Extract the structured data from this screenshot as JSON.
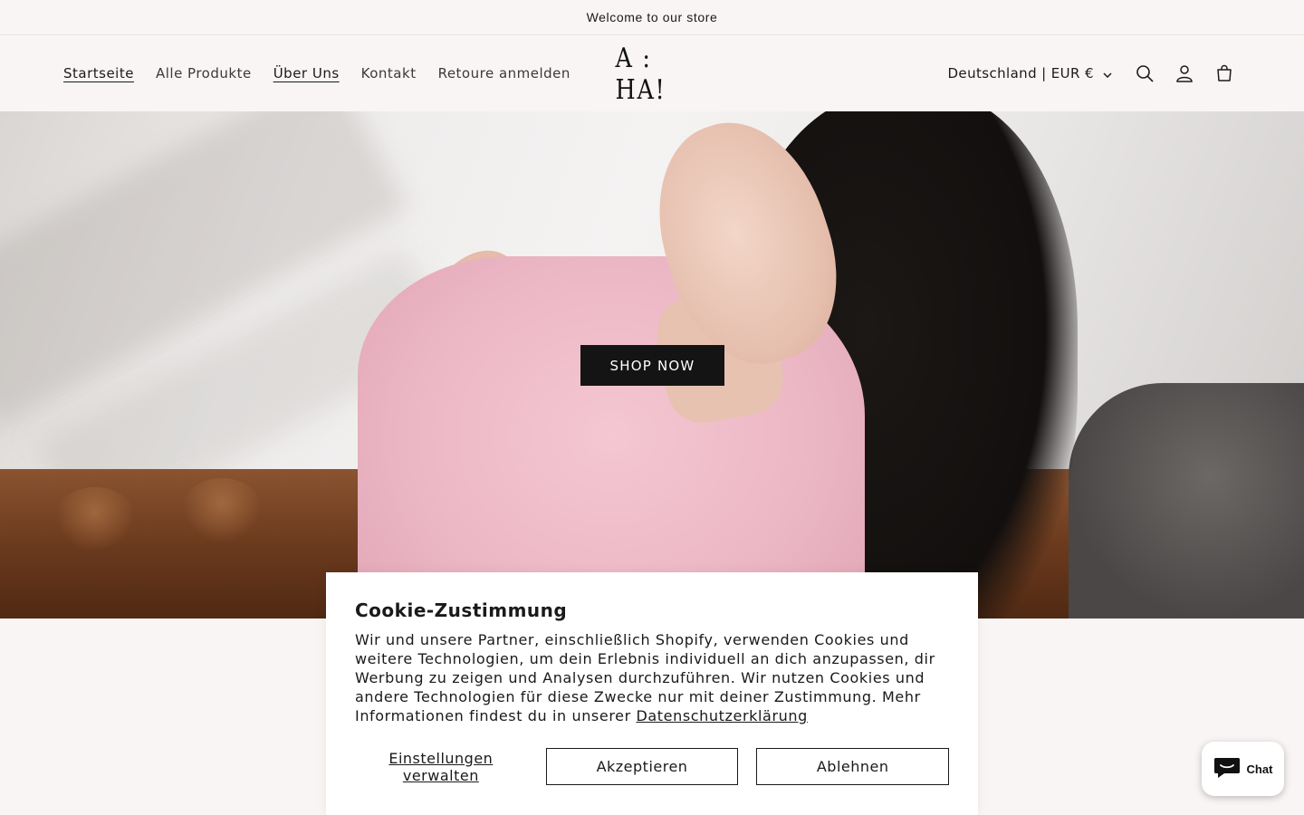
{
  "announcement": {
    "text": "Welcome to our store"
  },
  "nav": {
    "items": [
      {
        "label": "Startseite"
      },
      {
        "label": "Alle Produkte"
      },
      {
        "label": "Über Uns"
      },
      {
        "label": "Kontakt"
      },
      {
        "label": "Retoure anmelden"
      }
    ]
  },
  "logo": {
    "text": "A : HA!"
  },
  "header": {
    "country_selector": "Deutschland | EUR €",
    "icons": [
      "search-icon",
      "account-icon",
      "cart-icon"
    ]
  },
  "hero": {
    "cta_label": "SHOP NOW"
  },
  "cookie_banner": {
    "title": "Cookie-Zustimmung",
    "body": "Wir und unsere Partner, einschließlich Shopify, verwenden Cookies und weitere Technologien, um dein Erlebnis individuell an dich anzupassen, dir Werbung zu zeigen und Analysen durchzuführen. Wir nutzen Cookies und andere Technologien für diese Zwecke nur mit deiner Zustimmung. Mehr Informationen findest du in unserer",
    "privacy_link": "Datenschutzerklärung",
    "manage_label": "Einstellungen verwalten",
    "accept_label": "Akzeptieren",
    "decline_label": "Ablehnen"
  },
  "chat": {
    "label": "Chat"
  },
  "colors": {
    "background": "#f9f5f4",
    "cta_background": "#141414",
    "text": "#1a1a1a"
  }
}
